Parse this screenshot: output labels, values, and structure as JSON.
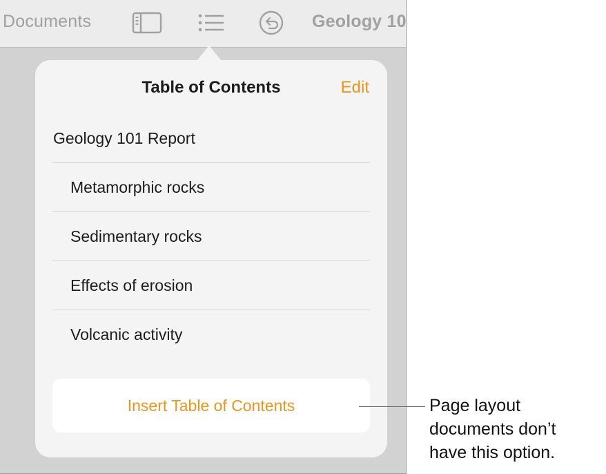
{
  "toolbar": {
    "documents_label": "Documents",
    "doc_title": "Geology 10",
    "icons": [
      "sidebar-icon",
      "list-icon",
      "undo-icon"
    ]
  },
  "popover": {
    "title": "Table of Contents",
    "edit_label": "Edit",
    "items": [
      {
        "label": "Geology 101 Report",
        "level": 1
      },
      {
        "label": "Metamorphic rocks",
        "level": 2
      },
      {
        "label": "Sedimentary rocks",
        "level": 2
      },
      {
        "label": "Effects of erosion",
        "level": 2
      },
      {
        "label": "Volcanic activity",
        "level": 2
      }
    ],
    "insert_label": "Insert Table of Contents"
  },
  "callout": {
    "lines": [
      "Page layout",
      "documents don’t",
      "have this option."
    ]
  },
  "colors": {
    "accent": "#e9951e",
    "toolbar_bg": "#ececec",
    "popover_bg": "#f4f4f4",
    "backdrop": "#d2d2d2"
  }
}
